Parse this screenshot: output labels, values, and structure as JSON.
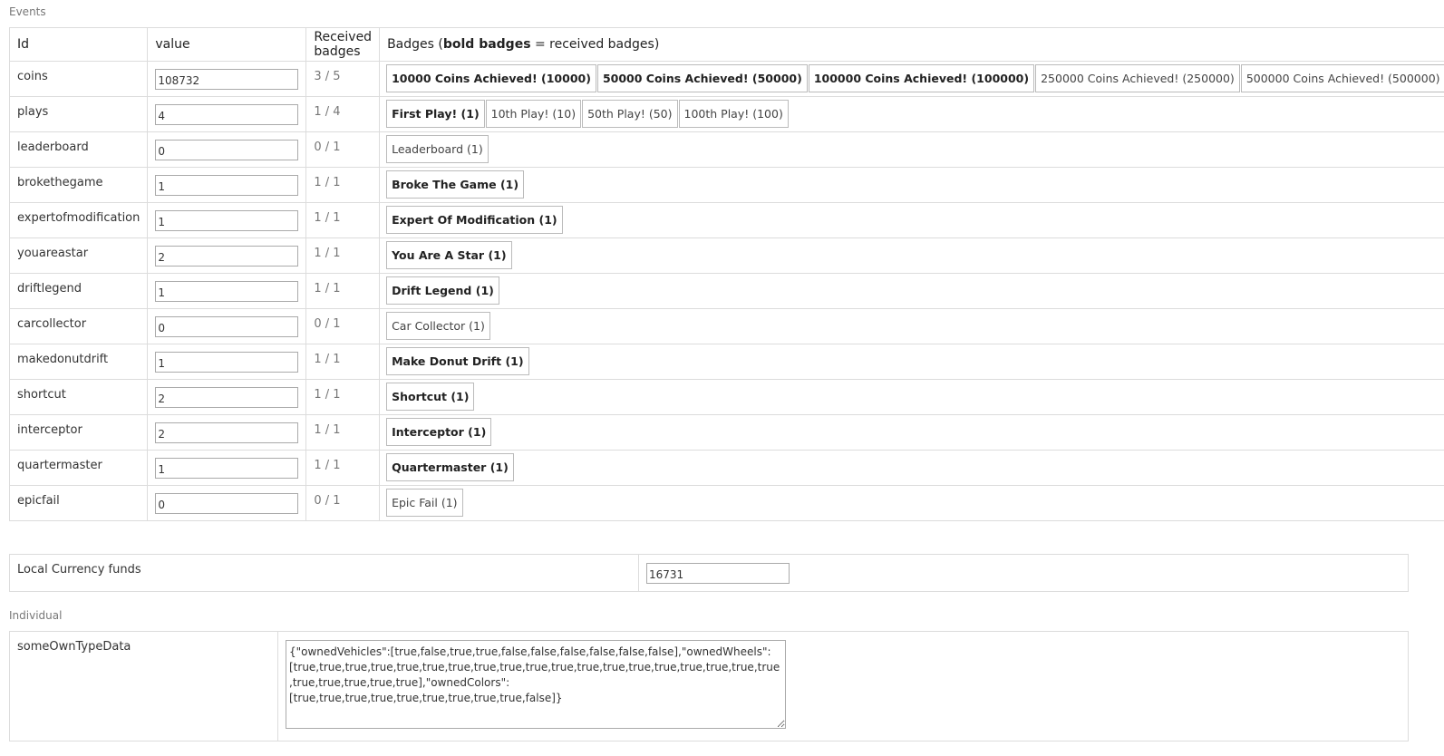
{
  "sections": {
    "events": "Events",
    "individual": "Individual"
  },
  "events_table": {
    "headers": {
      "id": "Id",
      "value": "value",
      "received": "Received badges",
      "badges_prefix": "Badges (",
      "badges_bold": "bold badges",
      "badges_suffix": " = received badges)"
    },
    "rows": [
      {
        "id": "coins",
        "value": "108732",
        "received": "3 / 5",
        "badges": [
          {
            "label": "10000 Coins Achieved! (10000)",
            "received": true
          },
          {
            "label": "50000 Coins Achieved! (50000)",
            "received": true
          },
          {
            "label": "100000 Coins Achieved! (100000)",
            "received": true
          },
          {
            "label": "250000 Coins Achieved! (250000)",
            "received": false
          },
          {
            "label": "500000 Coins Achieved! (500000)",
            "received": false
          }
        ]
      },
      {
        "id": "plays",
        "value": "4",
        "received": "1 / 4",
        "badges": [
          {
            "label": "First Play! (1)",
            "received": true
          },
          {
            "label": "10th Play! (10)",
            "received": false
          },
          {
            "label": "50th Play! (50)",
            "received": false
          },
          {
            "label": "100th Play! (100)",
            "received": false
          }
        ]
      },
      {
        "id": "leaderboard",
        "value": "0",
        "received": "0 / 1",
        "badges": [
          {
            "label": "Leaderboard (1)",
            "received": false
          }
        ]
      },
      {
        "id": "brokethegame",
        "value": "1",
        "received": "1 / 1",
        "badges": [
          {
            "label": "Broke The Game (1)",
            "received": true
          }
        ]
      },
      {
        "id": "expertofmodification",
        "value": "1",
        "received": "1 / 1",
        "badges": [
          {
            "label": "Expert Of Modification (1)",
            "received": true
          }
        ]
      },
      {
        "id": "youareastar",
        "value": "2",
        "received": "1 / 1",
        "badges": [
          {
            "label": "You Are A Star (1)",
            "received": true
          }
        ]
      },
      {
        "id": "driftlegend",
        "value": "1",
        "received": "1 / 1",
        "badges": [
          {
            "label": "Drift Legend (1)",
            "received": true
          }
        ]
      },
      {
        "id": "carcollector",
        "value": "0",
        "received": "0 / 1",
        "badges": [
          {
            "label": "Car Collector (1)",
            "received": false
          }
        ]
      },
      {
        "id": "makedonutdrift",
        "value": "1",
        "received": "1 / 1",
        "badges": [
          {
            "label": "Make Donut Drift (1)",
            "received": true
          }
        ]
      },
      {
        "id": "shortcut",
        "value": "2",
        "received": "1 / 1",
        "badges": [
          {
            "label": "Shortcut (1)",
            "received": true
          }
        ]
      },
      {
        "id": "interceptor",
        "value": "2",
        "received": "1 / 1",
        "badges": [
          {
            "label": "Interceptor (1)",
            "received": true
          }
        ]
      },
      {
        "id": "quartermaster",
        "value": "1",
        "received": "1 / 1",
        "badges": [
          {
            "label": "Quartermaster (1)",
            "received": true
          }
        ]
      },
      {
        "id": "epicfail",
        "value": "0",
        "received": "0 / 1",
        "badges": [
          {
            "label": "Epic Fail (1)",
            "received": false
          }
        ]
      }
    ]
  },
  "currency": {
    "label": "Local Currency funds",
    "value": "16731"
  },
  "individual": {
    "key": "someOwnTypeData",
    "value": "{\"ownedVehicles\":[true,false,true,true,false,false,false,false,false,false],\"ownedWheels\":[true,true,true,true,true,true,true,true,true,true,true,true,true,true,true,true,true,true,true,true,true,true,true,true],\"ownedColors\":[true,true,true,true,true,true,true,true,true,false]}"
  }
}
